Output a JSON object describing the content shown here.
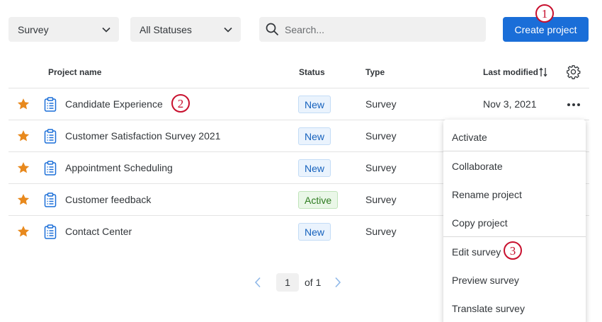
{
  "filters": {
    "type_select": "Survey",
    "status_select": "All Statuses",
    "search_placeholder": "Search...",
    "search_value": ""
  },
  "toolbar": {
    "create_label": "Create project"
  },
  "callouts": [
    "1",
    "2",
    "3"
  ],
  "table": {
    "headers": {
      "name": "Project name",
      "status": "Status",
      "type": "Type",
      "modified": "Last modified"
    },
    "rows": [
      {
        "name": "Candidate Experience",
        "status": "New",
        "type": "Survey",
        "modified": "Nov 3, 2021"
      },
      {
        "name": "Customer Satisfaction Survey 2021",
        "status": "New",
        "type": "Survey",
        "modified": ""
      },
      {
        "name": "Appointment Scheduling",
        "status": "New",
        "type": "Survey",
        "modified": ""
      },
      {
        "name": "Customer feedback",
        "status": "Active",
        "type": "Survey",
        "modified": ""
      },
      {
        "name": "Contact Center",
        "status": "New",
        "type": "Survey",
        "modified": ""
      }
    ]
  },
  "pagination": {
    "current": "1",
    "of_label": "of 1"
  },
  "context_menu": {
    "items": [
      "Activate",
      "Collaborate",
      "Rename project",
      "Copy project",
      "Edit survey",
      "Preview survey",
      "Translate survey"
    ]
  },
  "colors": {
    "primary": "#1a6ed8",
    "star": "#e8891d",
    "callout": "#c8102e",
    "clipboard": "#1a6ed8"
  }
}
